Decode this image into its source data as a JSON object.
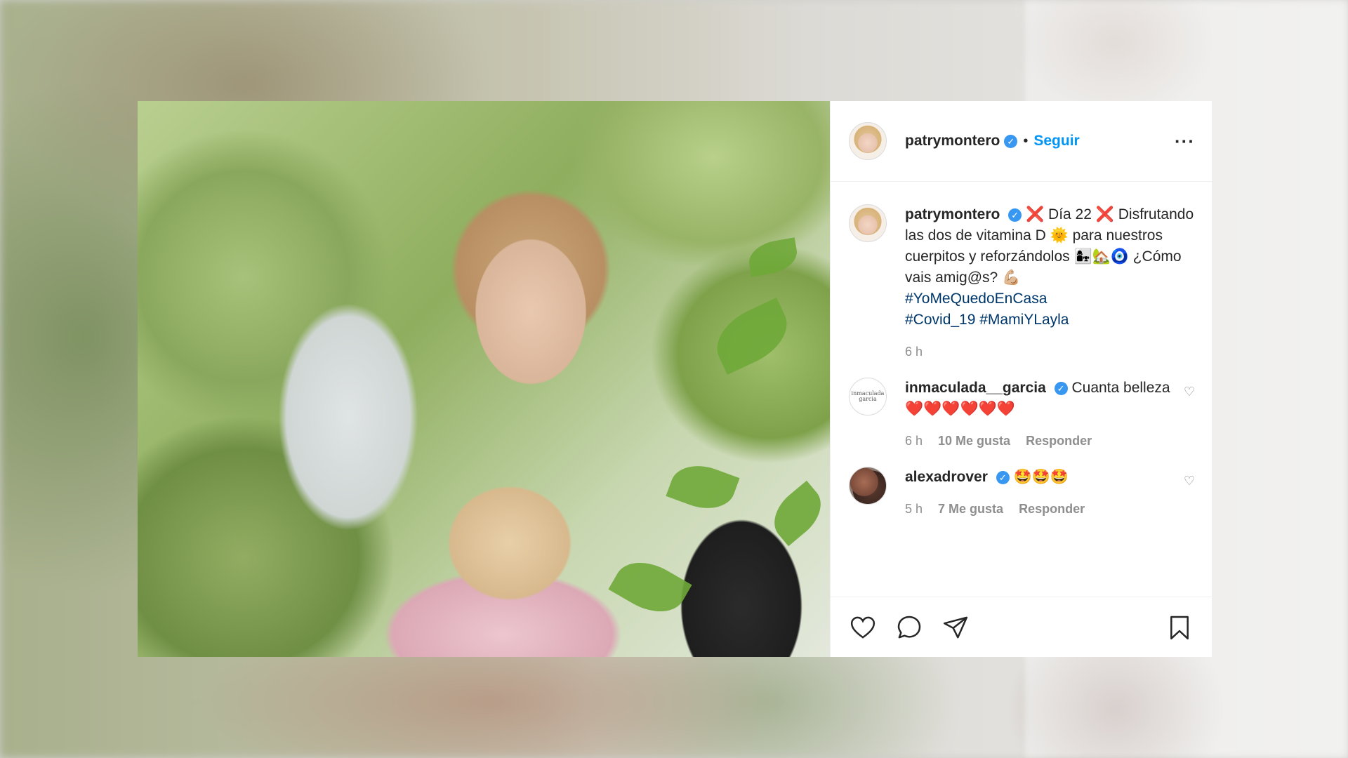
{
  "post": {
    "author": "patrymontero",
    "follow_label": "Seguir",
    "separator": "•",
    "more_label": "···",
    "caption": {
      "line1_prefix": "❌ Día 22 ❌",
      "text": "Disfrutando las dos de vitamina D 🌞 para nuestros cuerpitos y reforzándolos 👩‍👧🏡🧿 ¿Cómo vais amig@s? 💪🏼",
      "hashtags": [
        "#YoMeQuedoEnCasa",
        "#Covid_19",
        "#MamiYLayla"
      ],
      "time": "6 h"
    },
    "comments": [
      {
        "user": "inmaculada__garcia",
        "avatar_text": "inmaculada garcia",
        "text": "Cuanta belleza❤️❤️❤️❤️❤️❤️",
        "time": "6 h",
        "likes": "10 Me gusta",
        "reply": "Responder"
      },
      {
        "user": "alexadrover",
        "text": "🤩🤩🤩",
        "time": "5 h",
        "likes": "7 Me gusta",
        "reply": "Responder"
      }
    ]
  },
  "icons": {
    "like": "heart-icon",
    "comment": "comment-icon",
    "share": "share-icon",
    "save": "bookmark-icon",
    "verified": "verified-badge-icon",
    "comment_like": "small-heart-icon"
  },
  "colors": {
    "link": "#0095f6",
    "hashtag": "#00376b",
    "verified": "#3897f0",
    "muted": "#8e8e8e",
    "text": "#262626"
  }
}
